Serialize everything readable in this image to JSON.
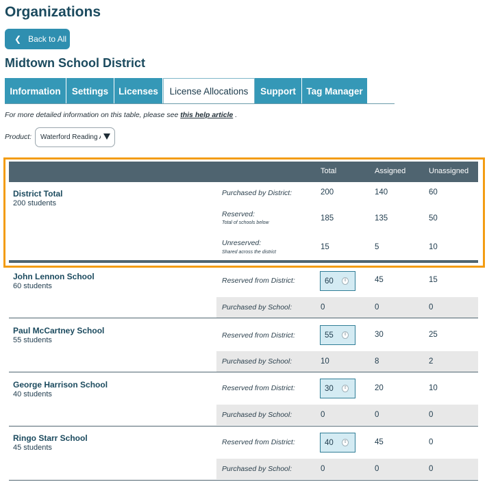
{
  "page_title": "Organizations",
  "back_button": "Back to All",
  "org_name": "Midtown School District",
  "tabs": [
    {
      "label": "Information"
    },
    {
      "label": "Settings"
    },
    {
      "label": "Licenses"
    },
    {
      "label": "License Allocations",
      "active": true
    },
    {
      "label": "Support"
    },
    {
      "label": "Tag Manager"
    }
  ],
  "help": {
    "prefix": "For more detailed information on this table, please see",
    "link": "this help article",
    "suffix": "."
  },
  "product": {
    "label": "Product:",
    "value": "Waterford Reading Academy"
  },
  "table_header": {
    "total": "Total",
    "assigned": "Assigned",
    "unassigned": "Unassigned"
  },
  "district": {
    "name": "District Total",
    "students": "200 students",
    "rows": [
      {
        "label": "Purchased by District:",
        "note": "",
        "total": "200",
        "assigned": "140",
        "unassigned": "60"
      },
      {
        "label": "Reserved:",
        "note": "Total of schools below",
        "total": "185",
        "assigned": "135",
        "unassigned": "50"
      },
      {
        "label": "Unreserved:",
        "note": "Shared across the district",
        "total": "15",
        "assigned": "5",
        "unassigned": "10"
      }
    ]
  },
  "schools": [
    {
      "name": "John Lennon School",
      "students": "60 students",
      "reserved_label": "Reserved from District:",
      "reserved_total": "60",
      "reserved_assigned": "45",
      "reserved_unassigned": "15",
      "purchased_label": "Purchased by School:",
      "purchased_total": "0",
      "purchased_assigned": "0",
      "purchased_unassigned": "0"
    },
    {
      "name": "Paul McCartney School",
      "students": "55 students",
      "reserved_label": "Reserved from District:",
      "reserved_total": "55",
      "reserved_assigned": "30",
      "reserved_unassigned": "25",
      "purchased_label": "Purchased by School:",
      "purchased_total": "10",
      "purchased_assigned": "8",
      "purchased_unassigned": "2"
    },
    {
      "name": "George Harrison School",
      "students": "40 students",
      "reserved_label": "Reserved from District:",
      "reserved_total": "30",
      "reserved_assigned": "20",
      "reserved_unassigned": "10",
      "purchased_label": "Purchased by School:",
      "purchased_total": "0",
      "purchased_assigned": "0",
      "purchased_unassigned": "0"
    },
    {
      "name": "Ringo Starr School",
      "students": "45 students",
      "reserved_label": "Reserved from District:",
      "reserved_total": "40",
      "reserved_assigned": "45",
      "reserved_unassigned": "0",
      "purchased_label": "Purchased by School:",
      "purchased_total": "0",
      "purchased_assigned": "0",
      "purchased_unassigned": "0"
    }
  ],
  "colors": {
    "accent": "#3598b7",
    "header": "#4f6470",
    "highlight": "#f39c12"
  },
  "icons": {
    "back": "chevron-left-icon",
    "select": "caret-down-icon",
    "stepper": "up-down-stepper-icon"
  }
}
